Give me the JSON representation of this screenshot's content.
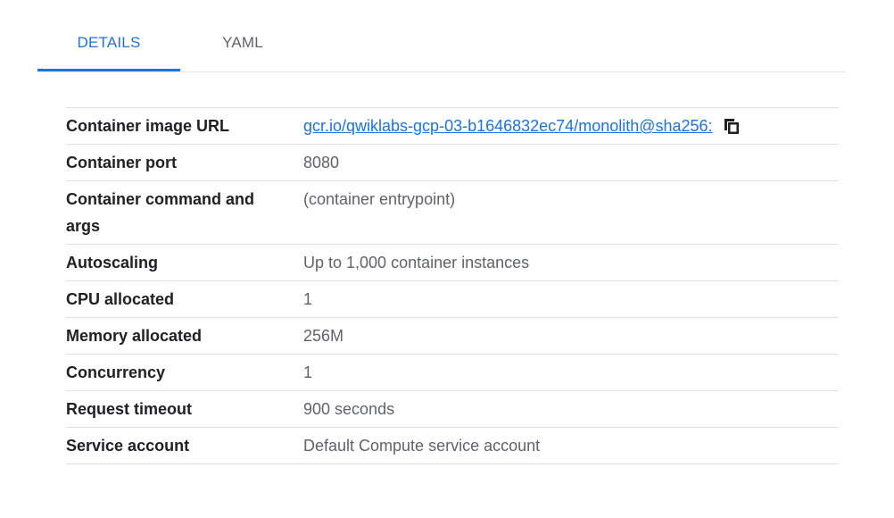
{
  "tabs": [
    {
      "label": "DETAILS",
      "active": true
    },
    {
      "label": "YAML",
      "active": false
    }
  ],
  "details": {
    "container_image_url": {
      "label": "Container image URL",
      "value": "gcr.io/qwiklabs-gcp-03-b1646832ec74/monolith@sha256:"
    },
    "container_port": {
      "label": "Container port",
      "value": "8080"
    },
    "container_command": {
      "label": "Container command and args",
      "value": "(container entrypoint)"
    },
    "autoscaling": {
      "label": "Autoscaling",
      "value": "Up to 1,000 container instances"
    },
    "cpu_allocated": {
      "label": "CPU allocated",
      "value": "1"
    },
    "memory_allocated": {
      "label": "Memory allocated",
      "value": "256M"
    },
    "concurrency": {
      "label": "Concurrency",
      "value": "1"
    },
    "request_timeout": {
      "label": "Request timeout",
      "value": "900 seconds"
    },
    "service_account": {
      "label": "Service account",
      "value": "Default Compute service account"
    }
  },
  "icons": {
    "copy": "copy-icon"
  },
  "colors": {
    "accent": "#1a73e8",
    "label_text": "#202124",
    "value_text": "#5f6368",
    "divider": "#e0e0e0"
  }
}
